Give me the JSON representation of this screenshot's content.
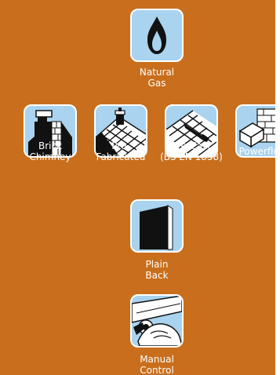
{
  "options": {
    "natural_gas": {
      "line1": "Natural",
      "line2": "Gas",
      "icon": "gas-flame-icon"
    },
    "brick_chimney": {
      "line1": "Brick",
      "line2": "Chimney",
      "icon": "brick-chimney-icon"
    },
    "prefabricated": {
      "line1": "Pre-",
      "line2": "Fabricated",
      "icon": "prefabricated-flue-icon"
    },
    "precast": {
      "line1": "Pre-Cast",
      "line2": "(BS EN 1858)",
      "icon": "precast-flue-icon"
    },
    "powerflue": {
      "line1": "Powerflue",
      "icon": "powerflue-icon"
    },
    "plain_back": {
      "line1": "Plain",
      "line2": "Back",
      "icon": "plain-back-icon"
    },
    "manual_control": {
      "line1": "Manual",
      "line2": "Control",
      "icon": "manual-control-icon"
    }
  },
  "colors": {
    "background": "#c96e1c",
    "tile": "#a9d3ef",
    "tile_border": "#ffffff",
    "label": "#ffffff"
  }
}
